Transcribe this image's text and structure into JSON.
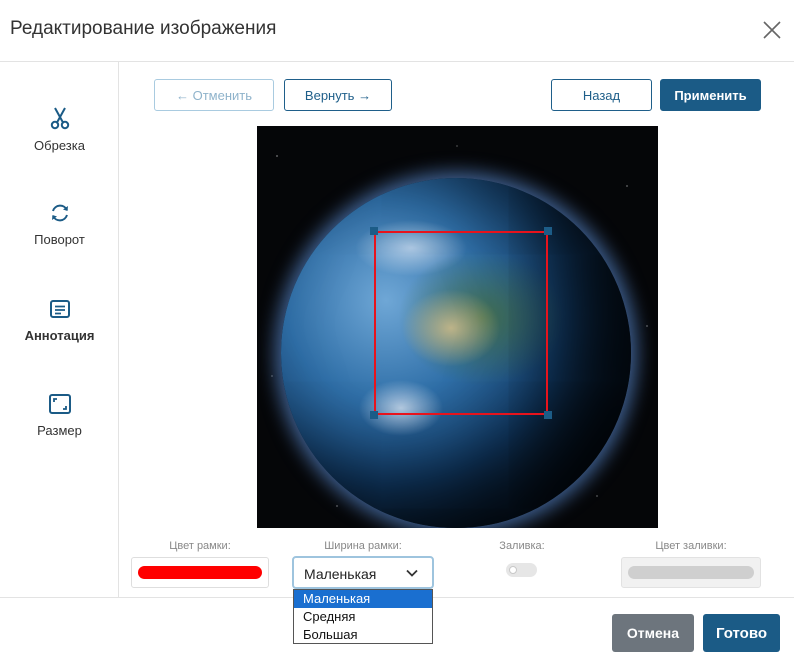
{
  "dialog": {
    "title": "Редактирование изображения"
  },
  "sidebar": {
    "items": [
      {
        "label": "Обрезка",
        "icon": "scissors-icon"
      },
      {
        "label": "Поворот",
        "icon": "rotate-icon"
      },
      {
        "label": "Аннотация",
        "icon": "annotation-icon",
        "active": true
      },
      {
        "label": "Размер",
        "icon": "resize-icon"
      }
    ]
  },
  "toolbar": {
    "undo_label": "← Отменить",
    "redo_label": "Вернуть →",
    "back_label": "Назад",
    "apply_label": "Применить"
  },
  "properties": {
    "border_color_label": "Цвет рамки:",
    "border_color": "#ff0000",
    "border_width_label": "Ширина рамки:",
    "border_width_value": "Маленькая",
    "fill_label": "Заливка:",
    "fill_enabled": false,
    "fill_color_label": "Цвет заливки:",
    "fill_color": "#cfcfcf"
  },
  "dropdown": {
    "options": [
      "Маленькая",
      "Средняя",
      "Большая"
    ],
    "selected": "Маленькая"
  },
  "footer": {
    "cancel_label": "Отмена",
    "done_label": "Готово"
  },
  "colors": {
    "accent": "#1b5b86",
    "annotation": "#e8131c",
    "cancel": "#6d757d"
  }
}
